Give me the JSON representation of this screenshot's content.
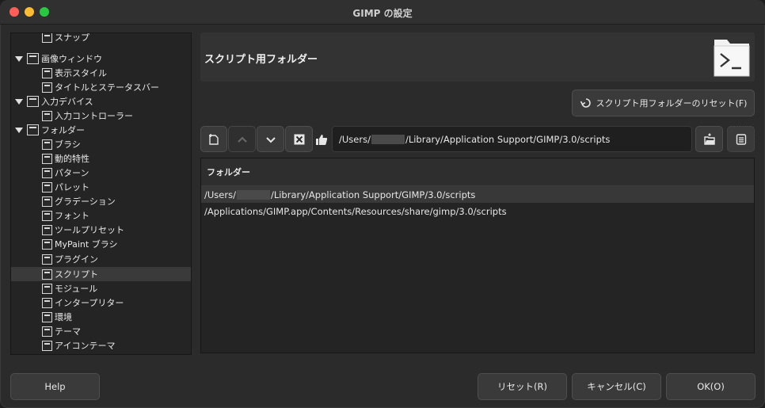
{
  "window": {
    "title": "GIMP の設定"
  },
  "sidebar": {
    "items": [
      {
        "label": "スナップ",
        "icon": "snap-icon",
        "level": 2
      },
      {
        "label": "画像ウィンドウ",
        "icon": "image-window-icon",
        "level": 1,
        "expanded": true
      },
      {
        "label": "表示スタイル",
        "icon": "appearance-icon",
        "level": 2
      },
      {
        "label": "タイトルとステータスバー",
        "icon": "titlebar-icon",
        "level": 2
      },
      {
        "label": "入力デバイス",
        "icon": "input-devices-icon",
        "level": 1,
        "expanded": true
      },
      {
        "label": "入力コントローラー",
        "icon": "controller-icon",
        "level": 2
      },
      {
        "label": "フォルダー",
        "icon": "folders-icon",
        "level": 1,
        "expanded": true
      },
      {
        "label": "ブラシ",
        "icon": "brush-icon",
        "level": 2
      },
      {
        "label": "動的特性",
        "icon": "dynamics-icon",
        "level": 2
      },
      {
        "label": "パターン",
        "icon": "pattern-icon",
        "level": 2
      },
      {
        "label": "パレット",
        "icon": "palette-icon",
        "level": 2
      },
      {
        "label": "グラデーション",
        "icon": "gradient-icon",
        "level": 2
      },
      {
        "label": "フォント",
        "icon": "font-icon",
        "level": 2
      },
      {
        "label": "ツールプリセット",
        "icon": "tool-preset-icon",
        "level": 2
      },
      {
        "label": "MyPaint ブラシ",
        "icon": "mypaint-brush-icon",
        "level": 2
      },
      {
        "label": "プラグイン",
        "icon": "plugin-icon",
        "level": 2
      },
      {
        "label": "スクリプト",
        "icon": "script-icon",
        "level": 2,
        "selected": true
      },
      {
        "label": "モジュール",
        "icon": "module-icon",
        "level": 2
      },
      {
        "label": "インタープリター",
        "icon": "interpreter-icon",
        "level": 2
      },
      {
        "label": "環境",
        "icon": "environment-icon",
        "level": 2
      },
      {
        "label": "テーマ",
        "icon": "theme-icon",
        "level": 2
      },
      {
        "label": "アイコンテーマ",
        "icon": "icon-theme-icon",
        "level": 2
      }
    ]
  },
  "header": {
    "title": "スクリプト用フォルダー",
    "icon": "script-folder-icon"
  },
  "reset_folders_button": {
    "label": "スクリプト用フォルダーのリセット(F)",
    "icon": "reset-icon"
  },
  "toolbar": {
    "new_icon": "new-folder-icon",
    "up_icon": "move-up-icon",
    "down_icon": "move-down-icon",
    "delete_icon": "delete-icon",
    "writable_icon": "thumbs-up-icon",
    "path_prefix": "/Users/",
    "path_suffix": "/Library/Application Support/GIMP/3.0/scripts",
    "browse_icon": "open-folder-icon",
    "edit_icon": "edit-icon"
  },
  "folder_list": {
    "header": "フォルダー",
    "rows": [
      {
        "prefix": "/Users/",
        "suffix": "/Library/Application Support/GIMP/3.0/scripts",
        "redacted": true,
        "selected": true
      },
      {
        "text": "/Applications/GIMP.app/Contents/Resources/share/gimp/3.0/scripts",
        "redacted": false,
        "selected": false
      }
    ]
  },
  "footer": {
    "help": "Help",
    "reset": "リセット(R)",
    "cancel": "キャンセル(C)",
    "ok": "OK(O)"
  },
  "colors": {
    "window_bg": "#2b2b2b",
    "panel_bg": "#242424",
    "selection": "#3a3a3a",
    "text": "#e6e6e6"
  }
}
